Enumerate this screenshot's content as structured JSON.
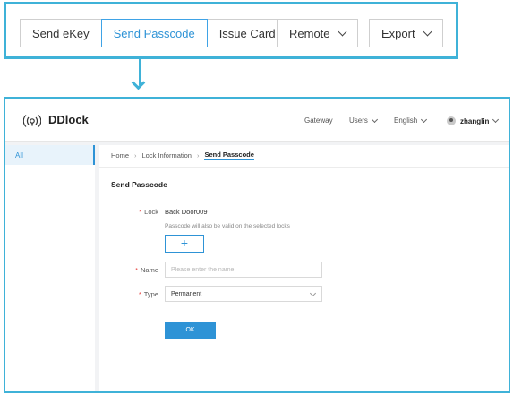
{
  "toolbar": {
    "tabs": [
      {
        "label": "Send eKey",
        "active": false
      },
      {
        "label": "Send Passcode",
        "active": true
      },
      {
        "label": "Issue Card",
        "active": false
      }
    ],
    "remote_label": "Remote",
    "export_label": "Export"
  },
  "app": {
    "brand": "DDlock",
    "nav": {
      "gateway": "Gateway",
      "users": "Users",
      "language": "English",
      "username": "zhanglin"
    },
    "sidebar": {
      "items": [
        {
          "label": "All",
          "selected": true
        }
      ]
    },
    "breadcrumb": [
      "Home",
      "Lock Information",
      "Send Passcode"
    ],
    "form": {
      "title": "Send Passcode",
      "lock_label": "Lock",
      "lock_value": "Back Door009",
      "lock_hint": "Passcode will also be valid on the selected locks",
      "add_symbol": "+",
      "name_label": "Name",
      "name_placeholder": "Please enter the name",
      "name_value": "",
      "type_label": "Type",
      "type_value": "Permanent",
      "required_mark": "*",
      "submit_label": "OK"
    }
  },
  "colors": {
    "accent": "#2e93d6",
    "callout": "#3fb2d8",
    "required": "#e64340"
  }
}
